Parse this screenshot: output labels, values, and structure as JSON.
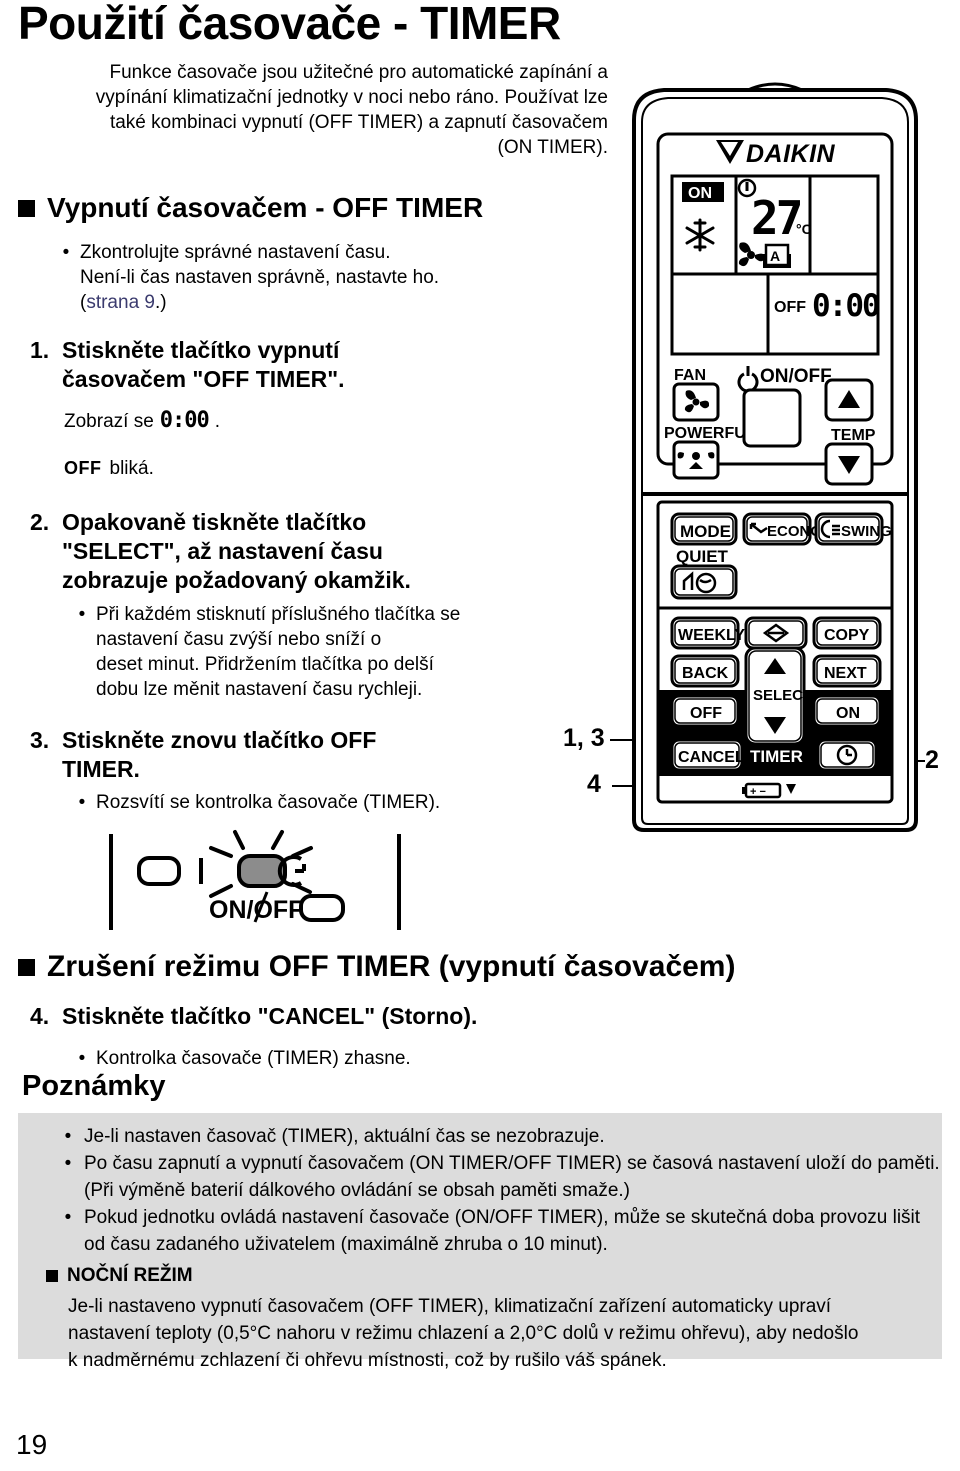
{
  "page": {
    "title": "Použití časovače - TIMER",
    "number": "19"
  },
  "intro": {
    "lines": [
      "Funkce časovače jsou užitečné pro automatické zapínání a",
      "vypínání klimatizační jednotky v noci nebo ráno. Používat lze",
      "také kombinaci vypnutí (OFF TIMER) a zapnutí časovačem",
      "(ON TIMER)."
    ]
  },
  "section_off_timer": {
    "heading": "Vypnutí časovačem - OFF TIMER",
    "check_bullet": {
      "dot": "•",
      "line1": "Zkontrolujte správné nastavení času.",
      "line2": "Není-li čas nastaven správně, nastavte ho.",
      "link_open": "(",
      "link_text": "strana 9",
      "link_close": ".)"
    },
    "step1": {
      "num": "1.",
      "text_line1": "Stiskněte tlačítko vypnutí",
      "text_line2": "časovačem \"OFF TIMER\".",
      "display_label": "Zobrazí se",
      "display_value": "0:00",
      "display_period": ".",
      "blink_badge": "OFF",
      "blink_text": "bliká."
    },
    "step2": {
      "num": "2.",
      "text_line1": "Opakovaně tiskněte tlačítko",
      "text_line2": "\"SELECT\", až nastavení času",
      "text_line3": "zobrazuje požadovaný okamžik.",
      "bullet_dot": "•",
      "bullet_line1": "Při každém stisknutí příslušného tlačítka se",
      "bullet_line2": "nastavení času zvýší nebo sníží o",
      "bullet_line3": "deset minut. Přidržením tlačítka po delší",
      "bullet_line4": "dobu lze měnit nastavení času rychleji."
    },
    "step3": {
      "num": "3.",
      "text_line1": "Stiskněte znovu tlačítko OFF",
      "text_line2": "TIMER.",
      "bullet_dot": "•",
      "bullet_line1": "Rozsvítí se kontrolka časovače (TIMER)."
    }
  },
  "section_cancel": {
    "heading": "Zrušení režimu OFF TIMER (vypnutí časovačem)",
    "step4": {
      "num": "4.",
      "text_line1": "Stiskněte tlačítko \"CANCEL\" (Storno).",
      "bullet_dot": "•",
      "bullet_line1": "Kontrolka časovače (TIMER) zhasne."
    }
  },
  "notes": {
    "heading": "Poznámky",
    "items": [
      {
        "dot": "•",
        "lines": [
          "Je-li nastaven časovač (TIMER), aktuální čas se nezobrazuje."
        ]
      },
      {
        "dot": "•",
        "lines": [
          "Po času zapnutí a vypnutí časovačem (ON TIMER/OFF TIMER) se časová nastavení uloží do paměti.",
          "(Při výměně baterií dálkového ovládání se obsah paměti smaže.)"
        ]
      },
      {
        "dot": "•",
        "lines": [
          "Pokud jednotku ovládá nastavení časovače (ON/OFF TIMER), může se skutečná doba provozu lišit",
          "od času zadaného uživatelem (maximálně zhruba o 10 minut)."
        ]
      }
    ],
    "nocni": {
      "heading": "NOČNÍ REŽIM",
      "lines": [
        "Je-li nastaveno vypnutí časovačem (OFF TIMER), klimatizační zařízení automaticky upraví",
        "nastavení teploty (0,5°C nahoru v režimu chlazení a 2,0°C dolů v režimu ohřevu), aby nedošlo",
        "k nadměrnému zchlazení či ohřevu místnosti, což by rušilo váš spánek."
      ]
    }
  },
  "remote": {
    "brand": "DAIKIN",
    "lcd": {
      "on_badge": "ON",
      "temp": "27",
      "unit": "°C",
      "fan_auto": "A",
      "off_label": "OFF",
      "off_time": "0:00"
    },
    "buttons": {
      "fan_label": "FAN",
      "powerful_label": "POWERFUL",
      "onoff_label": "ON/OFF",
      "temp_label": "TEMP",
      "mode": "MODE",
      "econo": "ECONO",
      "swing": "SWING",
      "quiet_label": "QUIET",
      "weekly": "WEEKLY",
      "copy": "COPY",
      "back": "BACK",
      "next": "NEXT",
      "select": "SELECT",
      "off": "OFF",
      "on": "ON",
      "cancel": "CANCEL",
      "timer_label": "TIMER",
      "battery": "+  −"
    }
  },
  "callouts": {
    "c13": "1, 3",
    "c4": "4",
    "c2": "2"
  },
  "lamp_panel": {
    "onoff_label": "ON/OFF"
  },
  "colors": {
    "link": "#3b3b6e",
    "notes_bg": "#dcdcdc",
    "ink": "#000000"
  }
}
